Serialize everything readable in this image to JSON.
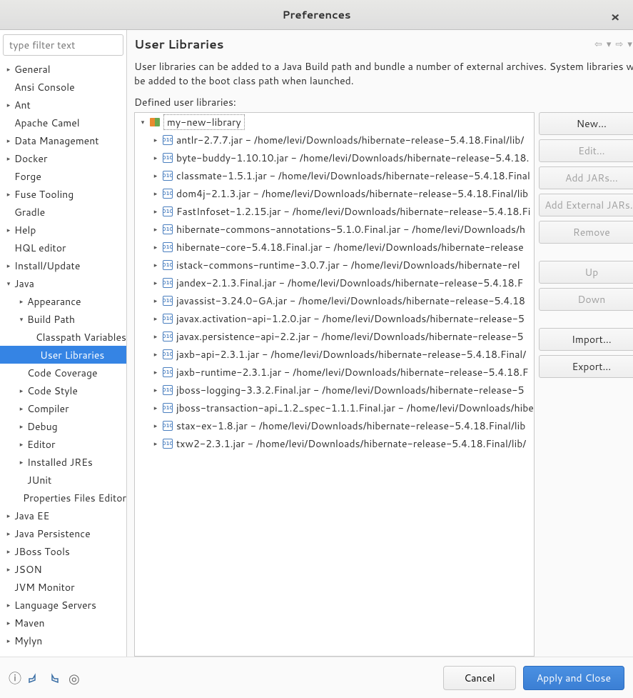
{
  "window": {
    "title": "Preferences"
  },
  "sidebar": {
    "filter_placeholder": "type filter text",
    "items": [
      {
        "label": "General",
        "depth": 0,
        "arrow": "▸"
      },
      {
        "label": "Ansi Console",
        "depth": 0,
        "arrow": ""
      },
      {
        "label": "Ant",
        "depth": 0,
        "arrow": "▸"
      },
      {
        "label": "Apache Camel",
        "depth": 0,
        "arrow": ""
      },
      {
        "label": "Data Management",
        "depth": 0,
        "arrow": "▸"
      },
      {
        "label": "Docker",
        "depth": 0,
        "arrow": "▸"
      },
      {
        "label": "Forge",
        "depth": 0,
        "arrow": ""
      },
      {
        "label": "Fuse Tooling",
        "depth": 0,
        "arrow": "▸"
      },
      {
        "label": "Gradle",
        "depth": 0,
        "arrow": ""
      },
      {
        "label": "Help",
        "depth": 0,
        "arrow": "▸"
      },
      {
        "label": "HQL editor",
        "depth": 0,
        "arrow": ""
      },
      {
        "label": "Install/Update",
        "depth": 0,
        "arrow": "▸"
      },
      {
        "label": "Java",
        "depth": 0,
        "arrow": "▾"
      },
      {
        "label": "Appearance",
        "depth": 1,
        "arrow": "▸"
      },
      {
        "label": "Build Path",
        "depth": 1,
        "arrow": "▾"
      },
      {
        "label": "Classpath Variables",
        "depth": 2,
        "arrow": ""
      },
      {
        "label": "User Libraries",
        "depth": 2,
        "arrow": "",
        "selected": true
      },
      {
        "label": "Code Coverage",
        "depth": 1,
        "arrow": ""
      },
      {
        "label": "Code Style",
        "depth": 1,
        "arrow": "▸"
      },
      {
        "label": "Compiler",
        "depth": 1,
        "arrow": "▸"
      },
      {
        "label": "Debug",
        "depth": 1,
        "arrow": "▸"
      },
      {
        "label": "Editor",
        "depth": 1,
        "arrow": "▸"
      },
      {
        "label": "Installed JREs",
        "depth": 1,
        "arrow": "▸"
      },
      {
        "label": "JUnit",
        "depth": 1,
        "arrow": ""
      },
      {
        "label": "Properties Files Editor",
        "depth": 1,
        "arrow": ""
      },
      {
        "label": "Java EE",
        "depth": 0,
        "arrow": "▸"
      },
      {
        "label": "Java Persistence",
        "depth": 0,
        "arrow": "▸"
      },
      {
        "label": "JBoss Tools",
        "depth": 0,
        "arrow": "▸"
      },
      {
        "label": "JSON",
        "depth": 0,
        "arrow": "▸"
      },
      {
        "label": "JVM Monitor",
        "depth": 0,
        "arrow": ""
      },
      {
        "label": "Language Servers",
        "depth": 0,
        "arrow": "▸"
      },
      {
        "label": "Maven",
        "depth": 0,
        "arrow": "▸"
      },
      {
        "label": "Mylyn",
        "depth": 0,
        "arrow": "▸"
      }
    ]
  },
  "page": {
    "title": "User Libraries",
    "description": "User libraries can be added to a Java Build path and bundle a number of external archives. System libraries will be added to the boot class path when launched.",
    "defined_label": "Defined user libraries:",
    "library_name": "my-new-library",
    "jars": [
      "antlr-2.7.7.jar - /home/levi/Downloads/hibernate-release-5.4.18.Final/lib/",
      "byte-buddy-1.10.10.jar - /home/levi/Downloads/hibernate-release-5.4.18.",
      "classmate-1.5.1.jar - /home/levi/Downloads/hibernate-release-5.4.18.Final",
      "dom4j-2.1.3.jar - /home/levi/Downloads/hibernate-release-5.4.18.Final/lib",
      "FastInfoset-1.2.15.jar - /home/levi/Downloads/hibernate-release-5.4.18.Fi",
      "hibernate-commons-annotations-5.1.0.Final.jar - /home/levi/Downloads/h",
      "hibernate-core-5.4.18.Final.jar - /home/levi/Downloads/hibernate-release",
      "istack-commons-runtime-3.0.7.jar - /home/levi/Downloads/hibernate-rel",
      "jandex-2.1.3.Final.jar - /home/levi/Downloads/hibernate-release-5.4.18.F",
      "javassist-3.24.0-GA.jar - /home/levi/Downloads/hibernate-release-5.4.18",
      "javax.activation-api-1.2.0.jar - /home/levi/Downloads/hibernate-release-5",
      "javax.persistence-api-2.2.jar - /home/levi/Downloads/hibernate-release-5",
      "jaxb-api-2.3.1.jar - /home/levi/Downloads/hibernate-release-5.4.18.Final/",
      "jaxb-runtime-2.3.1.jar - /home/levi/Downloads/hibernate-release-5.4.18.F",
      "jboss-logging-3.3.2.Final.jar - /home/levi/Downloads/hibernate-release-5",
      "jboss-transaction-api_1.2_spec-1.1.1.Final.jar - /home/levi/Downloads/hibe",
      "stax-ex-1.8.jar - /home/levi/Downloads/hibernate-release-5.4.18.Final/lib",
      "txw2-2.3.1.jar - /home/levi/Downloads/hibernate-release-5.4.18.Final/lib/"
    ],
    "buttons": {
      "new": "New...",
      "edit": "Edit...",
      "add_jars": "Add JARs...",
      "add_external": "Add External JARs...",
      "remove": "Remove",
      "up": "Up",
      "down": "Down",
      "import": "Import...",
      "export": "Export..."
    }
  },
  "footer": {
    "cancel": "Cancel",
    "apply_close": "Apply and Close"
  }
}
